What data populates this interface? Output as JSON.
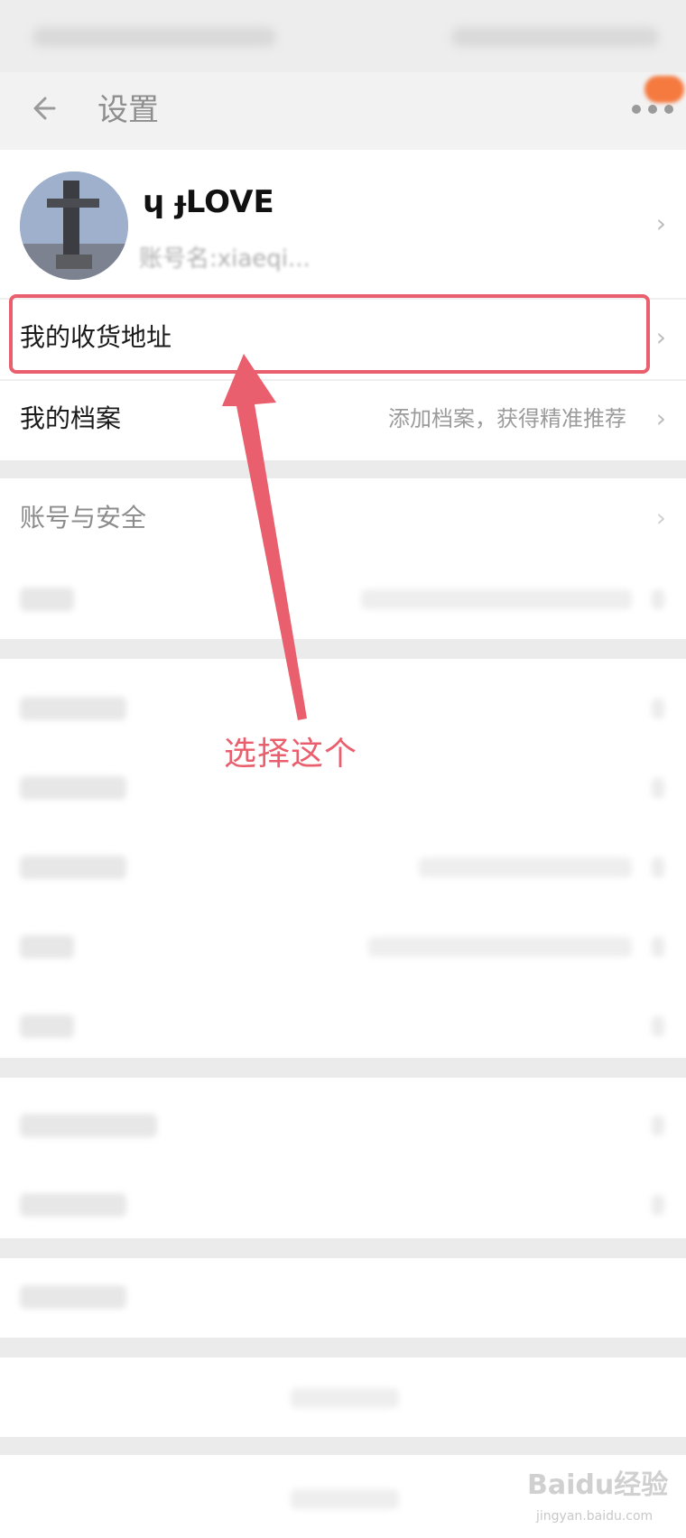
{
  "nav": {
    "title": "设置"
  },
  "profile": {
    "name": "ɥ ɟLOVE",
    "sub": "账号名:xiaeqi..."
  },
  "rows": [
    {
      "label": "我的收货地址",
      "value": ""
    },
    {
      "label": "我的档案",
      "value": "添加档案，获得精准推荐"
    },
    {
      "label": "账号与安全",
      "value": ""
    }
  ],
  "annotation": {
    "text": "选择这个"
  },
  "watermark": {
    "text": "Baidu经验",
    "sub": "jingyan.baidu.com"
  },
  "colors": {
    "accent": "#ea5f6d",
    "badge": "#f57a40",
    "background": "#f2f2f2"
  },
  "icons": {
    "back": "back-arrow-icon",
    "more": "more-dots-icon",
    "chevron": "chevron-right-icon"
  }
}
